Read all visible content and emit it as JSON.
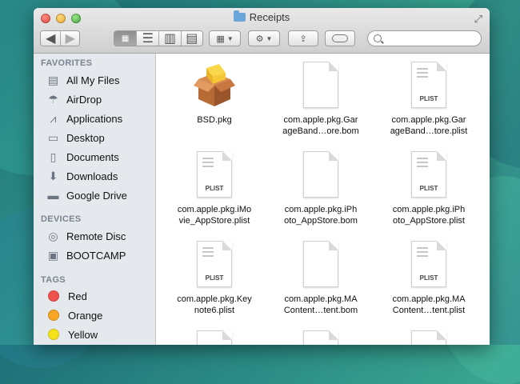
{
  "window": {
    "title": "Receipts"
  },
  "toolbar": {
    "back_icon": "chevron-left-icon",
    "forward_icon": "chevron-right-icon",
    "view_modes": [
      "icon-view",
      "list-view",
      "column-view",
      "cover-flow-view"
    ],
    "active_view": "icon-view",
    "arrange_icon": "arrange-grid-icon",
    "action_icon": "gear-icon",
    "share_icon": "share-icon",
    "tags_icon": "tags-icon",
    "search_placeholder": ""
  },
  "sidebar": {
    "favorites_label": "FAVORITES",
    "favorites": [
      {
        "label": "All My Files",
        "icon": "all-files-icon"
      },
      {
        "label": "AirDrop",
        "icon": "airdrop-icon"
      },
      {
        "label": "Applications",
        "icon": "applications-icon"
      },
      {
        "label": "Desktop",
        "icon": "desktop-icon"
      },
      {
        "label": "Documents",
        "icon": "documents-icon"
      },
      {
        "label": "Downloads",
        "icon": "downloads-icon"
      },
      {
        "label": "Google Drive",
        "icon": "folder-icon"
      }
    ],
    "devices_label": "DEVICES",
    "devices": [
      {
        "label": "Remote Disc",
        "icon": "disc-icon"
      },
      {
        "label": "BOOTCAMP",
        "icon": "drive-icon"
      }
    ],
    "tags_label": "TAGS",
    "tags": [
      {
        "label": "Red",
        "color": "#f0524d"
      },
      {
        "label": "Orange",
        "color": "#f6a623"
      },
      {
        "label": "Yellow",
        "color": "#f5e11a"
      }
    ]
  },
  "files": [
    {
      "line1": "BSD.pkg",
      "line2": "",
      "kind": "pkg"
    },
    {
      "line1": "com.apple.pkg.Gar",
      "line2": "ageBand…ore.bom",
      "kind": "bom"
    },
    {
      "line1": "com.apple.pkg.Gar",
      "line2": "ageBand…tore.plist",
      "kind": "plist"
    },
    {
      "line1": "com.apple.pkg.iMo",
      "line2": "vie_AppStore.plist",
      "kind": "plist"
    },
    {
      "line1": "com.apple.pkg.iPh",
      "line2": "oto_AppStore.bom",
      "kind": "bom"
    },
    {
      "line1": "com.apple.pkg.iPh",
      "line2": "oto_AppStore.plist",
      "kind": "plist"
    },
    {
      "line1": "com.apple.pkg.Key",
      "line2": "note6.plist",
      "kind": "plist"
    },
    {
      "line1": "com.apple.pkg.MA",
      "line2": "Content…tent.bom",
      "kind": "bom"
    },
    {
      "line1": "com.apple.pkg.MA",
      "line2": "Content…tent.plist",
      "kind": "plist"
    }
  ],
  "plist_badge": "PLIST"
}
